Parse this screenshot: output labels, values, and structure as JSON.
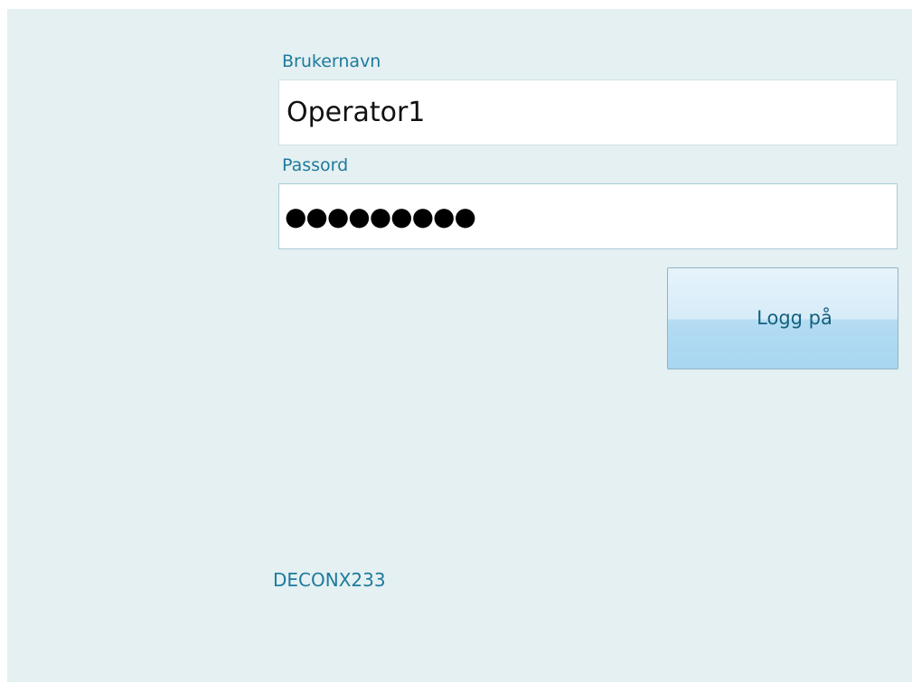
{
  "login": {
    "username_label": "Brukernavn",
    "username_value": "Operator1",
    "password_label": "Passord",
    "password_masked": "●●●●●●●●●",
    "login_button_label": "Logg på"
  },
  "footer": {
    "device_id": "DECONX233"
  },
  "colors": {
    "background": "#e4f0f2",
    "label": "#1e7a9c",
    "button_top": "#e6f3fb",
    "button_bottom": "#a8d6f1"
  }
}
